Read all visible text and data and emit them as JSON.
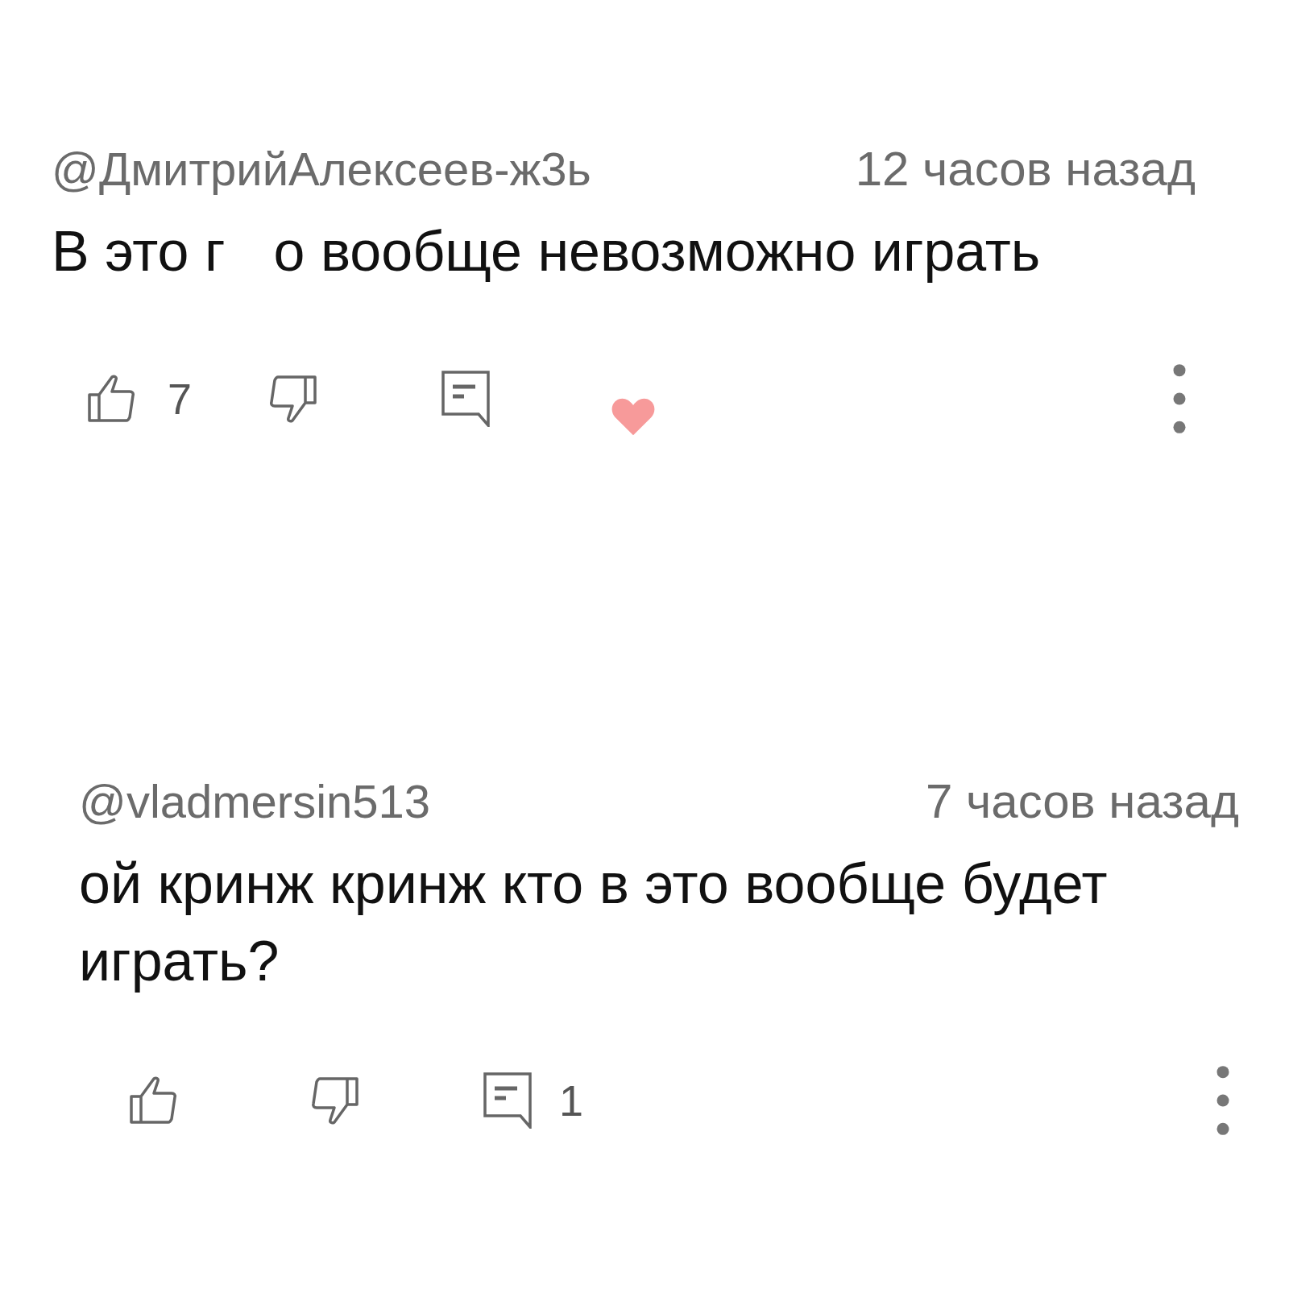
{
  "comments": [
    {
      "author": "@ДмитрийАлексеев-ж3ь",
      "time": "12 часов назад",
      "text_parts": [
        "В это г",
        "о вообще невозможно играть"
      ],
      "likes": "7",
      "creator_heart": true
    },
    {
      "author": "@vladmersin513",
      "time": "7 часов назад",
      "text_parts": [
        "ой кринж кринж кто в это вообще будет играть?"
      ],
      "replies": "1",
      "creator_heart": false
    }
  ]
}
